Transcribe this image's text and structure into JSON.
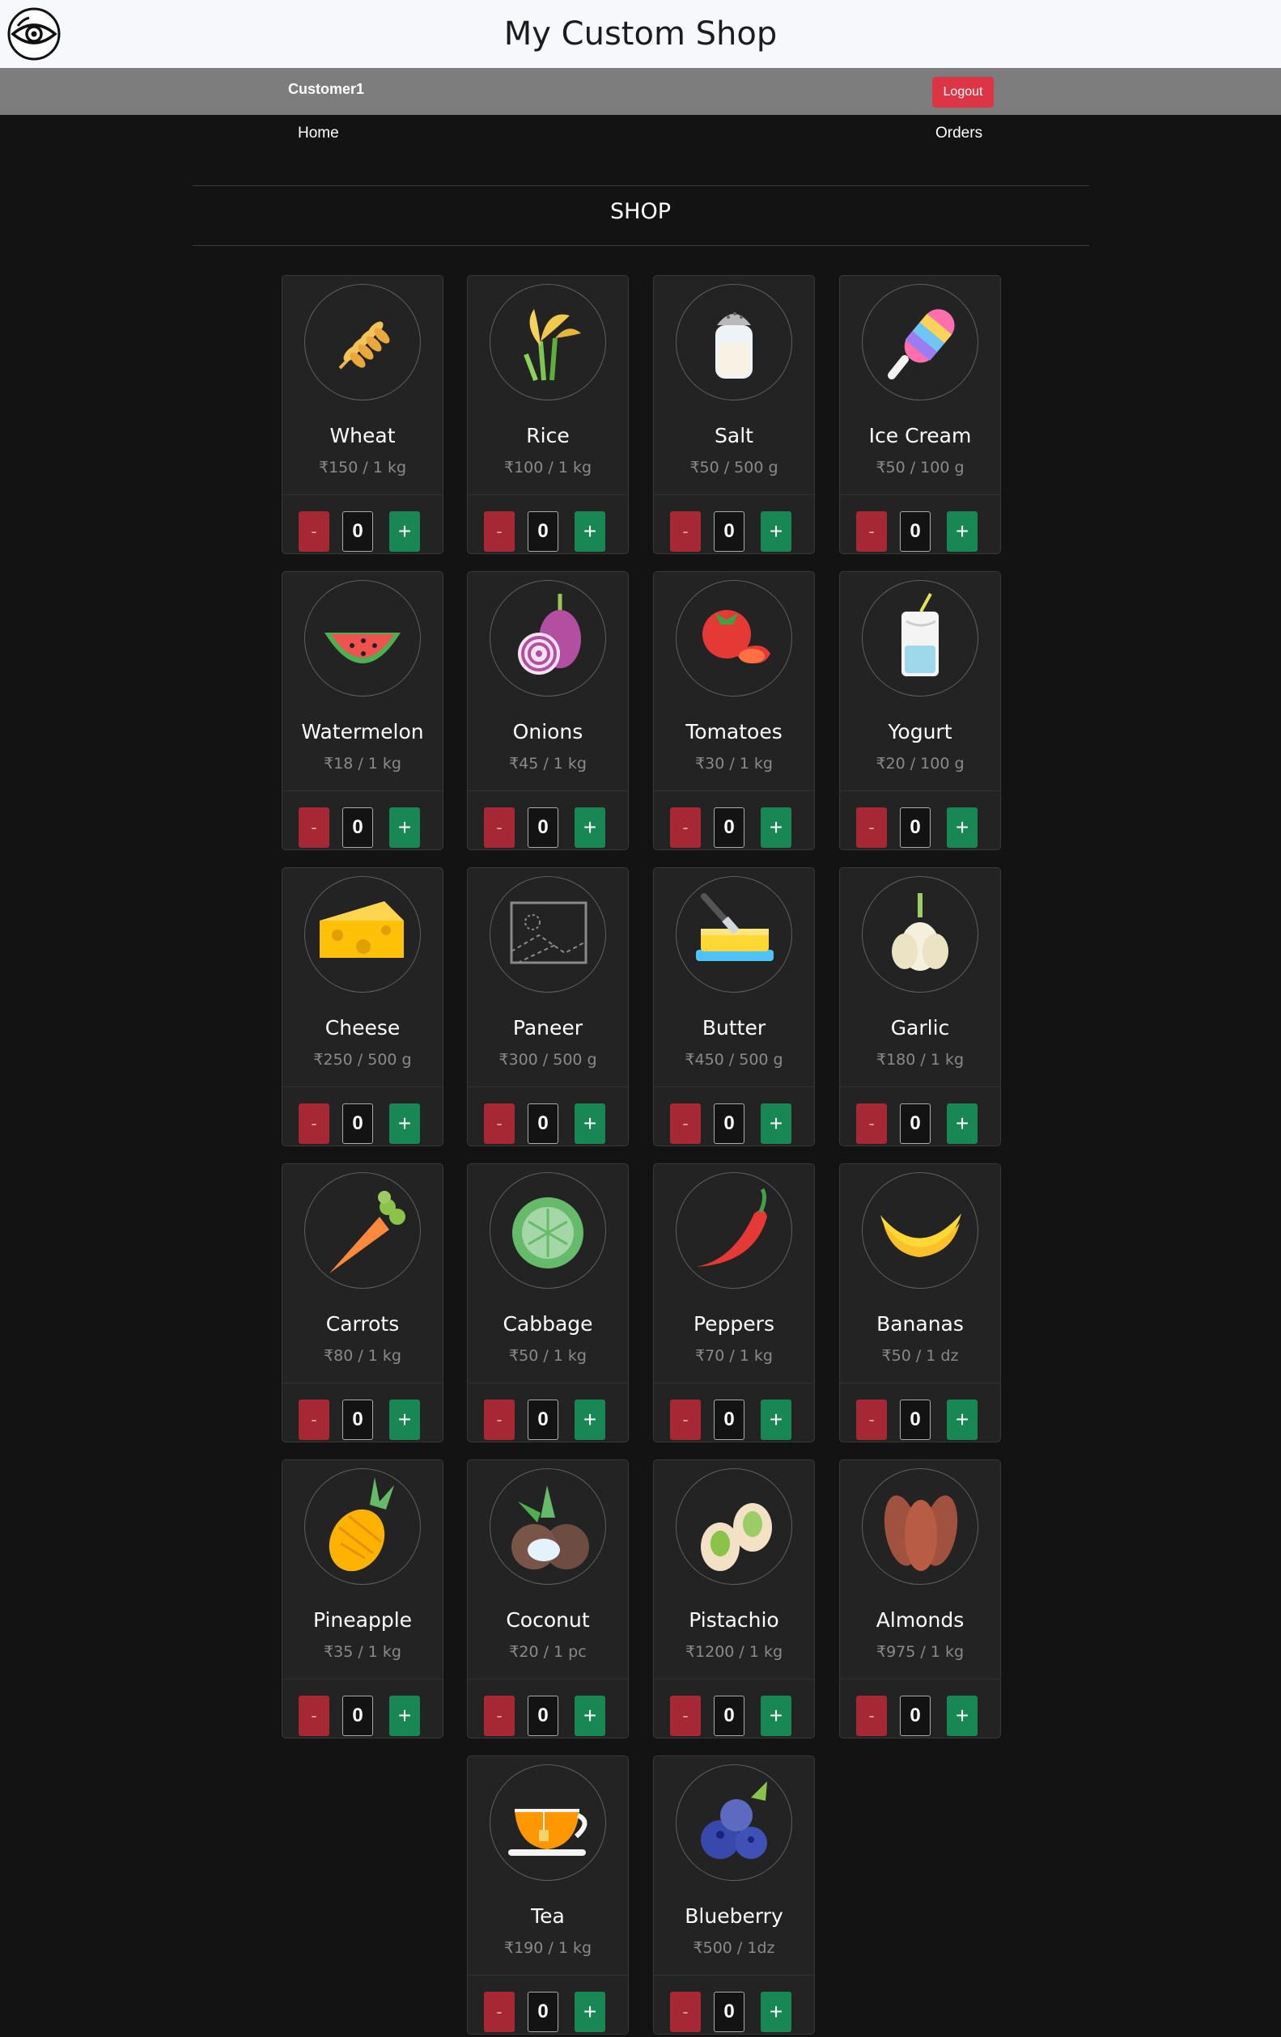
{
  "header": {
    "title": "My Custom Shop",
    "logo_icon": "eye-logo-icon"
  },
  "userbar": {
    "username": "Customer1",
    "logout_label": "Logout"
  },
  "nav": {
    "home": "Home",
    "orders": "Orders"
  },
  "section": {
    "title": "SHOP"
  },
  "colors": {
    "minus": "#a52834",
    "plus": "#198754",
    "logout": "#dc3545",
    "card": "#232323",
    "background": "#131313"
  },
  "products": [
    {
      "name": "Wheat",
      "price": "₹150  /  1 kg",
      "qty": "0",
      "icon": "wheat-icon"
    },
    {
      "name": "Rice",
      "price": "₹100  /  1 kg",
      "qty": "0",
      "icon": "rice-icon"
    },
    {
      "name": "Salt",
      "price": "₹50  /  500 g",
      "qty": "0",
      "icon": "salt-icon"
    },
    {
      "name": "Ice Cream",
      "price": "₹50  /  100 g",
      "qty": "0",
      "icon": "ice-cream-icon"
    },
    {
      "name": "Watermelon",
      "price": "₹18  /  1 kg",
      "qty": "0",
      "icon": "watermelon-icon"
    },
    {
      "name": "Onions",
      "price": "₹45  /  1 kg",
      "qty": "0",
      "icon": "onion-icon"
    },
    {
      "name": "Tomatoes",
      "price": "₹30  /  1 kg",
      "qty": "0",
      "icon": "tomato-icon"
    },
    {
      "name": "Yogurt",
      "price": "₹20  /  100 g",
      "qty": "0",
      "icon": "yogurt-icon"
    },
    {
      "name": "Cheese",
      "price": "₹250  /  500 g",
      "qty": "0",
      "icon": "cheese-icon"
    },
    {
      "name": "Paneer",
      "price": "₹300  /  500 g",
      "qty": "0",
      "icon": "image-placeholder-icon"
    },
    {
      "name": "Butter",
      "price": "₹450  /  500 g",
      "qty": "0",
      "icon": "butter-icon"
    },
    {
      "name": "Garlic",
      "price": "₹180  /  1 kg",
      "qty": "0",
      "icon": "garlic-icon"
    },
    {
      "name": "Carrots",
      "price": "₹80  /  1 kg",
      "qty": "0",
      "icon": "carrot-icon"
    },
    {
      "name": "Cabbage",
      "price": "₹50  /  1 kg",
      "qty": "0",
      "icon": "cabbage-icon"
    },
    {
      "name": "Peppers",
      "price": "₹70  /  1 kg",
      "qty": "0",
      "icon": "pepper-icon"
    },
    {
      "name": "Bananas",
      "price": "₹50  /  1 dz",
      "qty": "0",
      "icon": "banana-icon"
    },
    {
      "name": "Pineapple",
      "price": "₹35  /  1 kg",
      "qty": "0",
      "icon": "pineapple-icon"
    },
    {
      "name": "Coconut",
      "price": "₹20  /  1 pc",
      "qty": "0",
      "icon": "coconut-icon"
    },
    {
      "name": "Pistachio",
      "price": "₹1200  /  1 kg",
      "qty": "0",
      "icon": "pistachio-icon"
    },
    {
      "name": "Almonds",
      "price": "₹975  /  1 kg",
      "qty": "0",
      "icon": "almond-icon"
    },
    {
      "name": "Tea",
      "price": "₹190  /  1 kg",
      "qty": "0",
      "icon": "tea-icon"
    },
    {
      "name": "Blueberry",
      "price": "₹500  /  1dz",
      "qty": "0",
      "icon": "blueberry-icon"
    }
  ],
  "buttons": {
    "minus": "-",
    "plus": "+"
  }
}
